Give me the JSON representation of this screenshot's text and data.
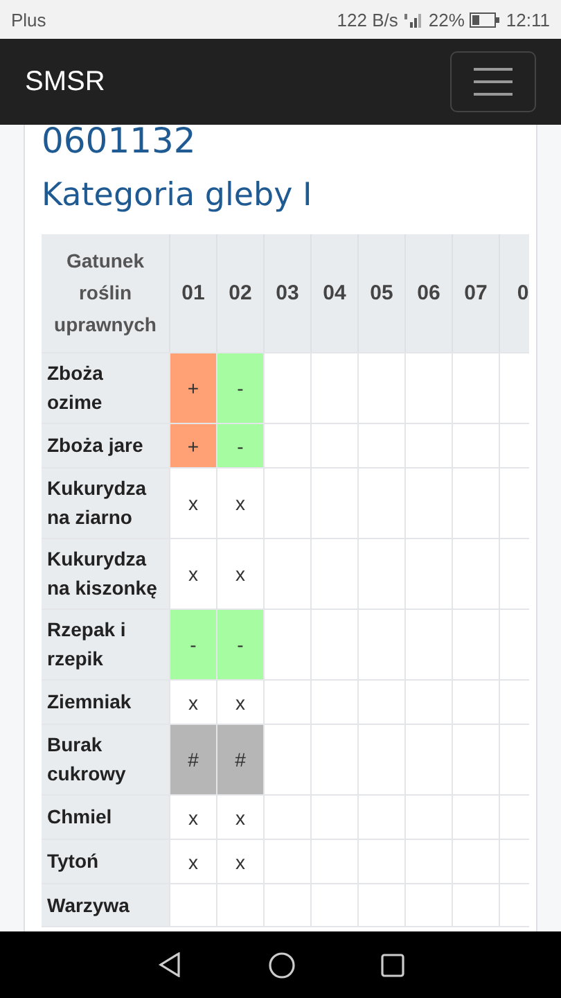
{
  "status_bar": {
    "carrier": "Plus",
    "speed": "122 B/s",
    "battery": "22%",
    "time": "12:11"
  },
  "navbar": {
    "brand": "SMSR"
  },
  "heading": "0601132",
  "subheading": "Kategoria gleby I",
  "table": {
    "corner": "Gatunek roślin uprawnych",
    "columns": [
      "01",
      "02",
      "03",
      "04",
      "05",
      "06",
      "07",
      "0"
    ],
    "rows": [
      {
        "label": "Zboża ozime",
        "cells": [
          {
            "text": "+",
            "kind": "plus"
          },
          {
            "text": "-",
            "kind": "minus"
          }
        ]
      },
      {
        "label": "Zboża jare",
        "cells": [
          {
            "text": "+",
            "kind": "plus"
          },
          {
            "text": "-",
            "kind": "minus"
          }
        ]
      },
      {
        "label": "Kukurydza na ziarno",
        "cells": [
          {
            "text": "x",
            "kind": "plain"
          },
          {
            "text": "x",
            "kind": "plain"
          }
        ]
      },
      {
        "label": "Kukurydza na kiszonkę",
        "cells": [
          {
            "text": "x",
            "kind": "plain"
          },
          {
            "text": "x",
            "kind": "plain"
          }
        ]
      },
      {
        "label": "Rzepak i rzepik",
        "cells": [
          {
            "text": "-",
            "kind": "minus"
          },
          {
            "text": "-",
            "kind": "minus"
          }
        ]
      },
      {
        "label": "Ziemniak",
        "cells": [
          {
            "text": "x",
            "kind": "plain"
          },
          {
            "text": "x",
            "kind": "plain"
          }
        ]
      },
      {
        "label": "Burak cukrowy",
        "cells": [
          {
            "text": "#",
            "kind": "hash"
          },
          {
            "text": "#",
            "kind": "hash"
          }
        ]
      },
      {
        "label": "Chmiel",
        "cells": [
          {
            "text": "x",
            "kind": "plain"
          },
          {
            "text": "x",
            "kind": "plain"
          }
        ]
      },
      {
        "label": "Tytoń",
        "cells": [
          {
            "text": "x",
            "kind": "plain"
          },
          {
            "text": "x",
            "kind": "plain"
          }
        ]
      },
      {
        "label": "Warzywa",
        "cells": []
      }
    ]
  }
}
